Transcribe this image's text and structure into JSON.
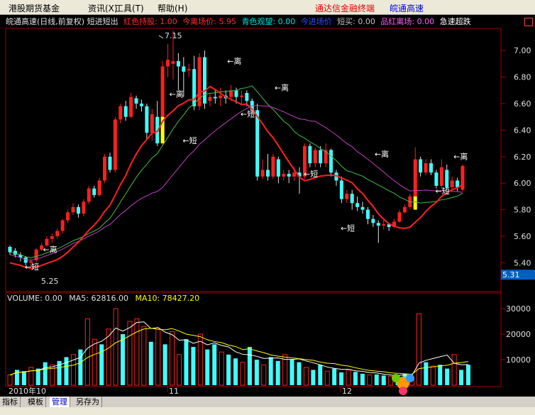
{
  "menu": {
    "items": [
      "港股期货基金",
      "资讯(X)",
      "工具(T)",
      "帮助(H)"
    ],
    "right_text1": "通达信金融终端",
    "right_text2": "皖通高速"
  },
  "info": {
    "prefix": "皖通高速(日线,前复权) 短进短出",
    "segments": [
      {
        "text": "红色持股: 1.00",
        "color": "#ff3030"
      },
      {
        "text": "今离场价: 5.95",
        "color": "#ff3030"
      },
      {
        "text": "青色观望: 0.00",
        "color": "#00e0e0"
      },
      {
        "text": "今进场价",
        "color": "#3050ff"
      },
      {
        "text": "短买: 0.00",
        "color": "#c0c0c0"
      },
      {
        "text": "品红离场: 0.00",
        "color": "#ff60ff"
      },
      {
        "text": "急速超跌",
        "color": "#ffffff"
      }
    ]
  },
  "price_axis": {
    "ticks": [
      "7.00",
      "6.80",
      "6.60",
      "6.40",
      "6.20",
      "6.00",
      "5.80",
      "5.60",
      "5.40"
    ],
    "current": "5.31"
  },
  "annotations": {
    "high": "7.15",
    "low": "5.25",
    "leave": "离",
    "short": "短"
  },
  "volume": {
    "label": "VOLUME: 0.00",
    "ma5": "MA5: 62816.00",
    "ma10": "MA10: 78427.20",
    "ticks": [
      "30000",
      "20000",
      "10000"
    ]
  },
  "dates": {
    "year": "2010年",
    "labels": [
      "10",
      "11",
      "12"
    ]
  },
  "tabs": [
    "指标",
    "模板",
    "管理",
    "另存为"
  ],
  "colors": {
    "up": "#ff2020",
    "down": "#40ffff",
    "yellow": "#ffff00"
  }
}
